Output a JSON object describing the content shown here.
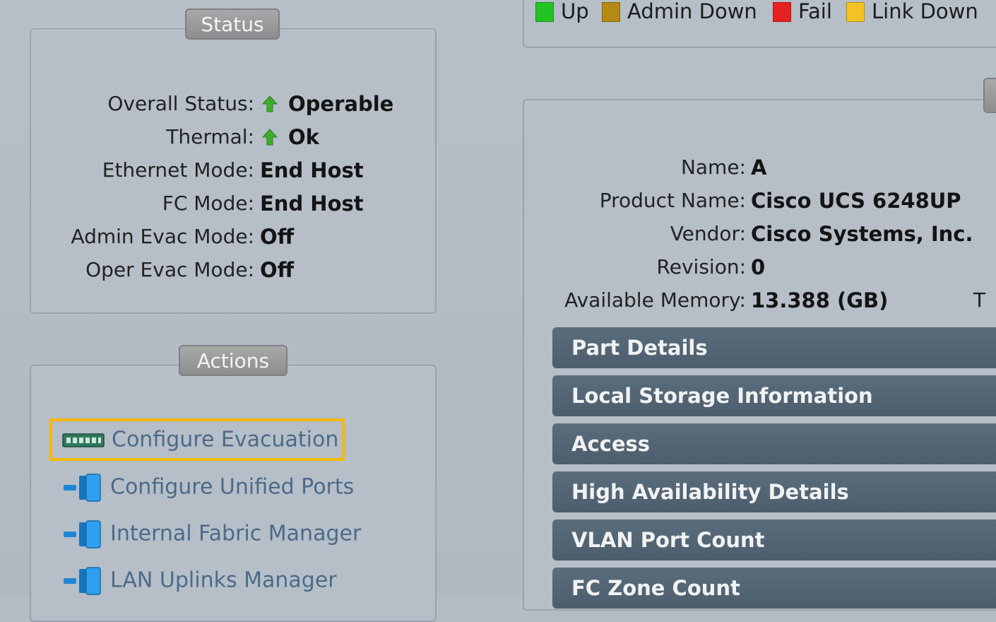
{
  "legend": {
    "items": [
      {
        "label": "Up",
        "color": "#22c322"
      },
      {
        "label": "Admin Down",
        "color": "#b58a14"
      },
      {
        "label": "Fail",
        "color": "#e52121"
      },
      {
        "label": "Link Down",
        "color": "#f3c325"
      }
    ]
  },
  "status": {
    "title": "Status",
    "rows": [
      {
        "label": "Overall Status:",
        "value": "Operable",
        "icon": "up-arrow-icon"
      },
      {
        "label": "Thermal:",
        "value": "Ok",
        "icon": "up-arrow-icon"
      },
      {
        "label": "Ethernet Mode:",
        "value": "End Host"
      },
      {
        "label": "FC Mode:",
        "value": "End Host"
      },
      {
        "label": "Admin Evac Mode:",
        "value": "Off"
      },
      {
        "label": "Oper Evac Mode:",
        "value": "Off"
      }
    ]
  },
  "actions": {
    "title": "Actions",
    "items": [
      {
        "label": "Configure Evacuation",
        "icon": "evacuation-icon",
        "highlighted": true
      },
      {
        "label": "Configure Unified Ports",
        "icon": "port-icon"
      },
      {
        "label": "Internal Fabric Manager",
        "icon": "port-icon"
      },
      {
        "label": "LAN Uplinks Manager",
        "icon": "port-icon"
      }
    ]
  },
  "properties": {
    "rows": [
      {
        "label": "Name:",
        "value": "A"
      },
      {
        "label": "Product Name:",
        "value": "Cisco UCS 6248UP"
      },
      {
        "label": "Vendor:",
        "value": "Cisco Systems, Inc."
      },
      {
        "label": "Revision:",
        "value": "0"
      },
      {
        "label": "Available Memory:",
        "value": "13.388 (GB)"
      }
    ],
    "truncated_label": "T"
  },
  "sections": [
    {
      "label": "Part Details"
    },
    {
      "label": "Local Storage Information"
    },
    {
      "label": "Access"
    },
    {
      "label": "High Availability Details"
    },
    {
      "label": "VLAN Port Count"
    },
    {
      "label": "FC Zone Count"
    }
  ],
  "colors": {
    "highlight": "#f5b800",
    "section_bar": "#52656f",
    "action_text": "#4b6b8a",
    "status_arrow": "#3cae2c"
  }
}
